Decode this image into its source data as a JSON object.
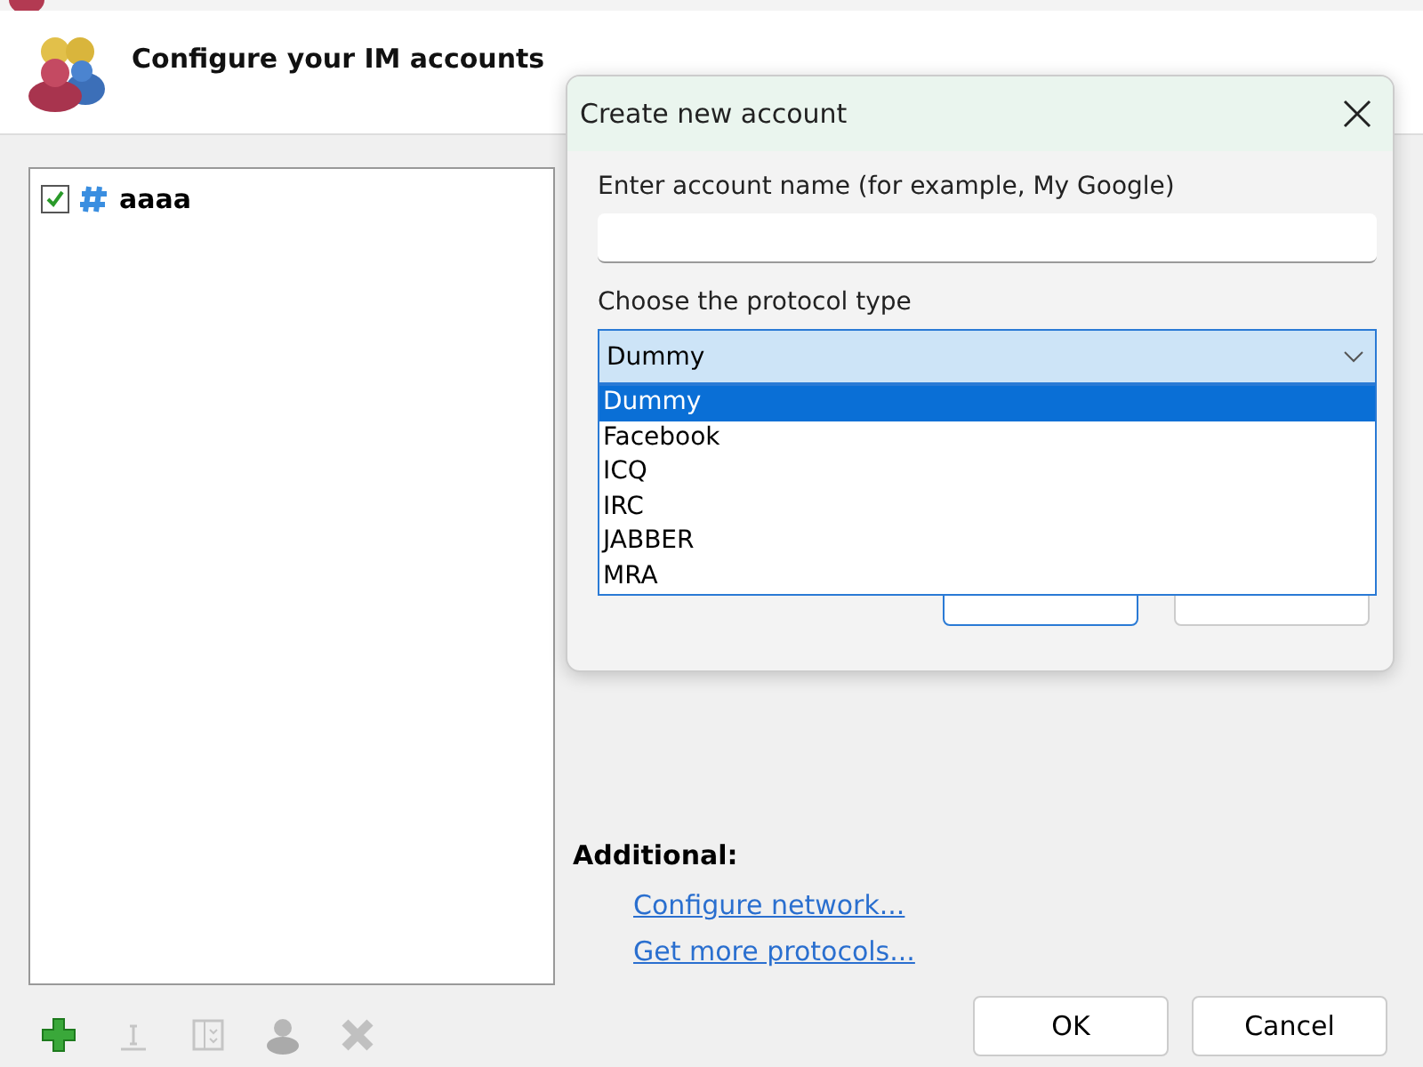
{
  "header": {
    "title": "Configure your IM accounts"
  },
  "accounts": [
    {
      "name": "aaaa",
      "checked": true
    }
  ],
  "toolbar": [
    {
      "kind": "add",
      "disabled": false
    },
    {
      "kind": "rename",
      "disabled": true
    },
    {
      "kind": "edit",
      "disabled": true
    },
    {
      "kind": "user",
      "disabled": true
    },
    {
      "kind": "delete",
      "disabled": true
    }
  ],
  "additional": {
    "heading": "Additional:",
    "links": [
      "Configure network...",
      "Get more protocols..."
    ]
  },
  "buttons": [
    "OK",
    "Cancel"
  ],
  "dialog": {
    "title": "Create new account",
    "name_label": "Enter account name (for example, My Google)",
    "protocol_label": "Choose the protocol type",
    "protocol_value": "Dummy",
    "options": [
      {
        "label": "Dummy",
        "selected": true
      },
      {
        "label": "Facebook",
        "selected": false
      },
      {
        "label": "ICQ",
        "selected": false
      },
      {
        "label": "IRC",
        "selected": false
      },
      {
        "label": "JABBER",
        "selected": false
      },
      {
        "label": "MRA",
        "selected": false
      }
    ]
  }
}
